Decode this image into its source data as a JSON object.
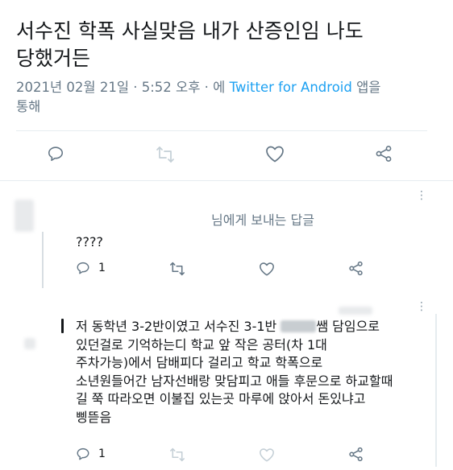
{
  "tweet": {
    "text_line1": "서수진 학폭 사실맞음 내가 산증인임 나도",
    "text_line2": "당했거든",
    "datetime": "2021년 02월 21일 · 5:52 오후 · 에 ",
    "client": "Twitter for Android",
    "client_suffix": " 앱을",
    "meta_line2": "통해"
  },
  "replies": [
    {
      "reply_to": "님에게 보내는 답글",
      "text": "????",
      "reply_count": "1"
    },
    {
      "lines": [
        "저 동학년 3-2반이였고 서수진 3-1반 ",
        "쌤 담임으로",
        "있던걸로 기억하는디 학교 앞 작은 공터(차 1대",
        "주차가능)에서 담배피다 걸리고 학교 학폭으로",
        "소년원들어간 남자선배랑 맞담피고 애들 후문으로 하교할때",
        "길 쭉 따라오면 이불집 있는곳 마루에 앉아서 돈있냐고",
        "삥뜯음"
      ],
      "reply_count": "1"
    }
  ],
  "icons": [
    "reply-icon",
    "retweet-icon",
    "like-icon",
    "share-icon",
    "more-icon"
  ],
  "colors": {
    "link": "#1da1f2",
    "meta": "#657786",
    "icon": "#657786",
    "divider": "#e6ecf0"
  }
}
